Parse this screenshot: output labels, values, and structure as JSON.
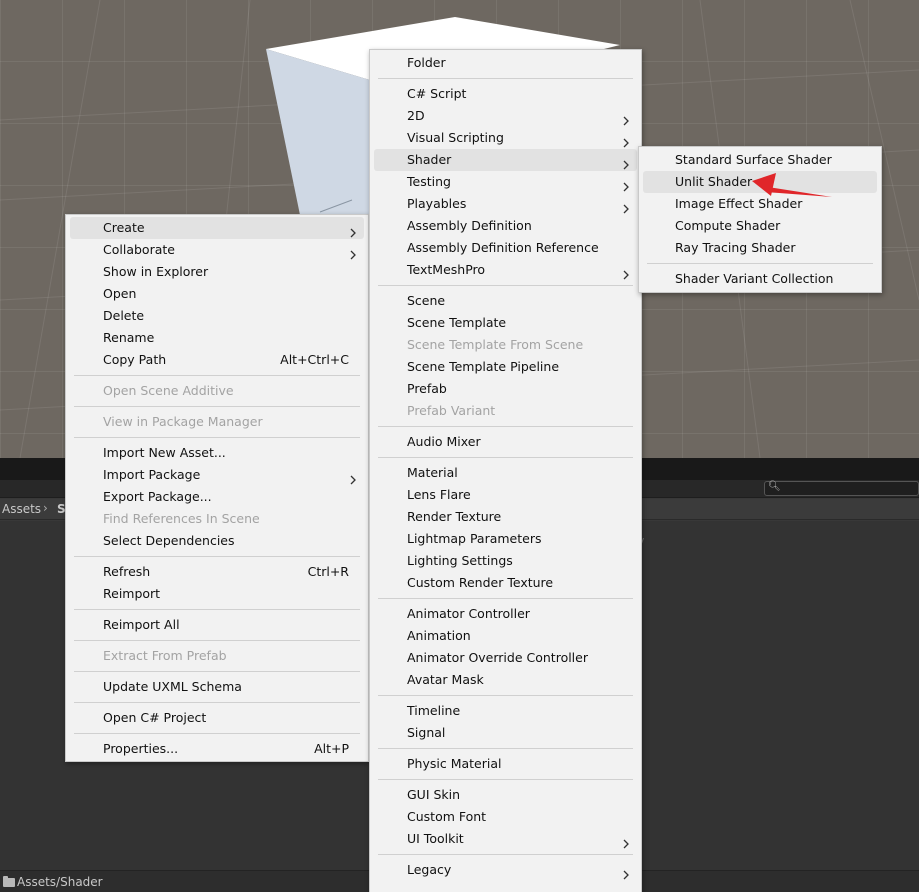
{
  "context_menu": {
    "items": [
      {
        "label": "Create",
        "shortcut": "",
        "submenu": true
      },
      {
        "label": "Collaborate",
        "shortcut": "",
        "submenu": true
      },
      {
        "label": "Show in Explorer",
        "shortcut": ""
      },
      {
        "label": "Open",
        "shortcut": ""
      },
      {
        "label": "Delete",
        "shortcut": ""
      },
      {
        "label": "Rename",
        "shortcut": ""
      },
      {
        "label": "Copy Path",
        "shortcut": "Alt+Ctrl+C"
      },
      {
        "label": "Open Scene Additive",
        "disabled": true
      },
      {
        "label": "View in Package Manager",
        "disabled": true
      },
      {
        "label": "Import New Asset..."
      },
      {
        "label": "Import Package",
        "submenu": true
      },
      {
        "label": "Export Package..."
      },
      {
        "label": "Find References In Scene",
        "disabled": true
      },
      {
        "label": "Select Dependencies"
      },
      {
        "label": "Refresh",
        "shortcut": "Ctrl+R"
      },
      {
        "label": "Reimport"
      },
      {
        "label": "Reimport All"
      },
      {
        "label": "Extract From Prefab",
        "disabled": true
      },
      {
        "label": "Update UXML Schema"
      },
      {
        "label": "Open C# Project"
      },
      {
        "label": "Properties...",
        "shortcut": "Alt+P"
      }
    ]
  },
  "create_menu": {
    "items": [
      {
        "label": "Folder"
      },
      {
        "label": "C# Script"
      },
      {
        "label": "2D",
        "submenu": true
      },
      {
        "label": "Visual Scripting",
        "submenu": true
      },
      {
        "label": "Shader",
        "submenu": true
      },
      {
        "label": "Testing",
        "submenu": true
      },
      {
        "label": "Playables",
        "submenu": true
      },
      {
        "label": "Assembly Definition"
      },
      {
        "label": "Assembly Definition Reference"
      },
      {
        "label": "TextMeshPro",
        "submenu": true
      },
      {
        "label": "Scene"
      },
      {
        "label": "Scene Template"
      },
      {
        "label": "Scene Template From Scene",
        "disabled": true
      },
      {
        "label": "Scene Template Pipeline"
      },
      {
        "label": "Prefab"
      },
      {
        "label": "Prefab Variant",
        "disabled": true
      },
      {
        "label": "Audio Mixer"
      },
      {
        "label": "Material"
      },
      {
        "label": "Lens Flare"
      },
      {
        "label": "Render Texture"
      },
      {
        "label": "Lightmap Parameters"
      },
      {
        "label": "Lighting Settings"
      },
      {
        "label": "Custom Render Texture"
      },
      {
        "label": "Animator Controller"
      },
      {
        "label": "Animation"
      },
      {
        "label": "Animator Override Controller"
      },
      {
        "label": "Avatar Mask"
      },
      {
        "label": "Timeline"
      },
      {
        "label": "Signal"
      },
      {
        "label": "Physic Material"
      },
      {
        "label": "GUI Skin"
      },
      {
        "label": "Custom Font"
      },
      {
        "label": "UI Toolkit",
        "submenu": true
      },
      {
        "label": "Legacy",
        "submenu": true
      }
    ]
  },
  "shader_menu": {
    "items": [
      {
        "label": "Standard Surface Shader"
      },
      {
        "label": "Unlit Shader"
      },
      {
        "label": "Image Effect Shader"
      },
      {
        "label": "Compute Shader"
      },
      {
        "label": "Ray Tracing Shader"
      },
      {
        "label": "Shader Variant Collection"
      }
    ]
  },
  "project": {
    "breadcrumb_root": "Assets",
    "breadcrumb_folder": "S",
    "empty_hint": "pty",
    "status_path": "Assets/Shader"
  },
  "colors": {
    "annotation_arrow": "#e0262a",
    "menu_bg": "#f2f2f2",
    "highlight": "#e2e2e2"
  }
}
